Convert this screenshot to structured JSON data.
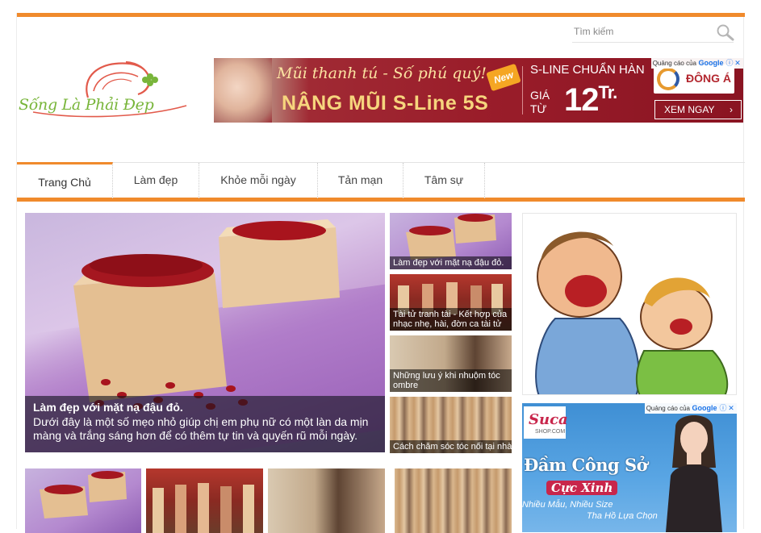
{
  "search": {
    "placeholder": "Tìm kiếm"
  },
  "logo": {
    "text": "Sống Là Phải Đẹp"
  },
  "top_ad": {
    "slogan": "Mũi thanh tú - Số phú quý!",
    "product": "NÂNG MŨI S-Line 5S",
    "badge": "New",
    "headline": "S-LINE CHUẨN HÀN",
    "price_prefix_1": "GIÁ",
    "price_prefix_2": "TỪ",
    "price": "12",
    "price_unit": "Tr.",
    "brand": "ĐÔNG Á",
    "cta": "XEM NGAY",
    "adchoice": "Quảng cáo của",
    "adchoice_brand": "Google"
  },
  "nav": {
    "items": [
      {
        "label": "Trang Chủ",
        "active": true
      },
      {
        "label": "Làm đẹp",
        "active": false
      },
      {
        "label": "Khỏe mỗi ngày",
        "active": false
      },
      {
        "label": "Tản mạn",
        "active": false
      },
      {
        "label": "Tâm sự",
        "active": false
      }
    ]
  },
  "hero": {
    "title": "Làm đẹp với mặt nạ đậu đỏ.",
    "description": "Dưới đây là một số mẹo nhỏ giúp chị em phụ nữ có một làn da mịn màng và trắng sáng hơn để có thêm tự tin và quyến rũ mỗi ngày."
  },
  "side_posts": [
    {
      "title": "Làm đẹp với mặt nạ đậu đỏ."
    },
    {
      "title": "Tài tử tranh tài - Kết hợp của nhạc nhẹ, hài, đờn ca tài tử"
    },
    {
      "title": "Những lưu ý khi nhuộm tóc ombre"
    },
    {
      "title": "Cách chăm sóc tóc nối tại nhà"
    }
  ],
  "right_ad": {
    "brand": "Suca",
    "brand_sub": "SHOP.COM",
    "title": "Đầm Công Sở",
    "subtitle": "Cực Xinh",
    "line1": "Nhiều Mẫu, Nhiều Size",
    "line2": "Tha Hồ Lựa Chọn",
    "adchoice": "Quảng cáo của",
    "adchoice_brand": "Google"
  },
  "colors": {
    "accent": "#f08a2c",
    "logo_green": "#78b53a",
    "logo_red": "#e25a4b",
    "ad_red": "#9a1d2a"
  }
}
